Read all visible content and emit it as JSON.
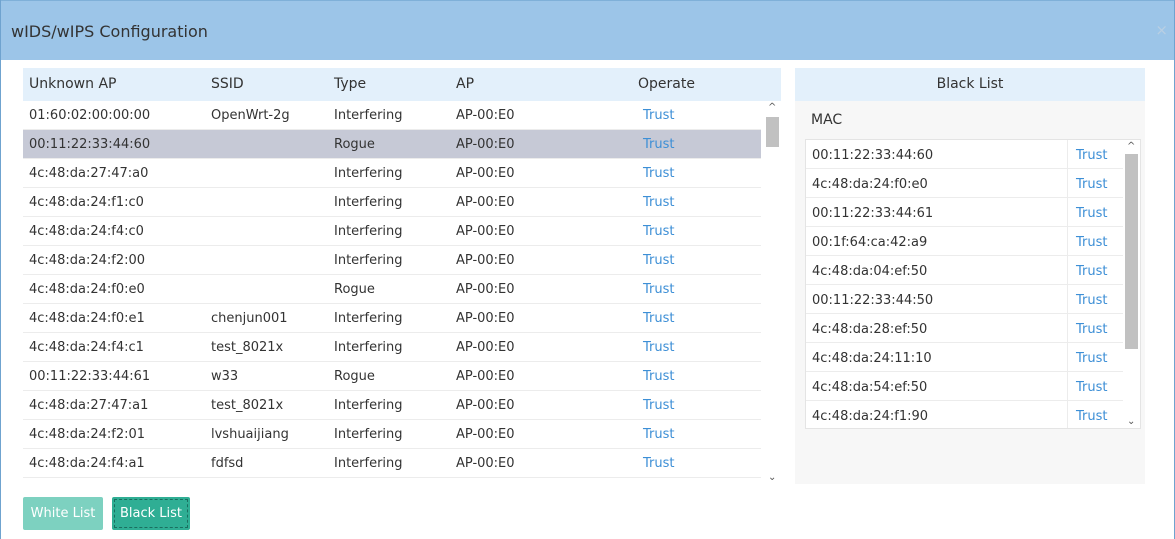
{
  "dialog": {
    "title": "wIDS/wIPS Configuration",
    "close": "×"
  },
  "left_table": {
    "headers": [
      "Unknown AP",
      "SSID",
      "Type",
      "AP",
      "Operate"
    ],
    "rows": [
      {
        "mac": "01:60:02:00:00:00",
        "ssid": "OpenWrt-2g",
        "type": "Interfering",
        "ap": "AP-00:E0",
        "op": "Trust"
      },
      {
        "mac": "00:11:22:33:44:60",
        "ssid": "",
        "type": "Rogue",
        "ap": "AP-00:E0",
        "op": "Trust"
      },
      {
        "mac": "4c:48:da:27:47:a0",
        "ssid": "",
        "type": "Interfering",
        "ap": "AP-00:E0",
        "op": "Trust"
      },
      {
        "mac": "4c:48:da:24:f1:c0",
        "ssid": "",
        "type": "Interfering",
        "ap": "AP-00:E0",
        "op": "Trust"
      },
      {
        "mac": "4c:48:da:24:f4:c0",
        "ssid": "",
        "type": "Interfering",
        "ap": "AP-00:E0",
        "op": "Trust"
      },
      {
        "mac": "4c:48:da:24:f2:00",
        "ssid": "",
        "type": "Interfering",
        "ap": "AP-00:E0",
        "op": "Trust"
      },
      {
        "mac": "4c:48:da:24:f0:e0",
        "ssid": "",
        "type": "Rogue",
        "ap": "AP-00:E0",
        "op": "Trust"
      },
      {
        "mac": "4c:48:da:24:f0:e1",
        "ssid": "chenjun001",
        "type": "Interfering",
        "ap": "AP-00:E0",
        "op": "Trust"
      },
      {
        "mac": "4c:48:da:24:f4:c1",
        "ssid": "test_8021x",
        "type": "Interfering",
        "ap": "AP-00:E0",
        "op": "Trust"
      },
      {
        "mac": "00:11:22:33:44:61",
        "ssid": "w33",
        "type": "Rogue",
        "ap": "AP-00:E0",
        "op": "Trust"
      },
      {
        "mac": "4c:48:da:27:47:a1",
        "ssid": "test_8021x",
        "type": "Interfering",
        "ap": "AP-00:E0",
        "op": "Trust"
      },
      {
        "mac": "4c:48:da:24:f2:01",
        "ssid": "lvshuaijiang",
        "type": "Interfering",
        "ap": "AP-00:E0",
        "op": "Trust"
      },
      {
        "mac": "4c:48:da:24:f4:a1",
        "ssid": "fdfsd",
        "type": "Interfering",
        "ap": "AP-00:E0",
        "op": "Trust"
      }
    ],
    "selected_row": 1
  },
  "black_list": {
    "title": "Black List",
    "mac_label": "MAC",
    "rows": [
      {
        "mac": "00:11:22:33:44:60",
        "op": "Trust"
      },
      {
        "mac": "4c:48:da:24:f0:e0",
        "op": "Trust"
      },
      {
        "mac": "00:11:22:33:44:61",
        "op": "Trust"
      },
      {
        "mac": "00:1f:64:ca:42:a9",
        "op": "Trust"
      },
      {
        "mac": "4c:48:da:04:ef:50",
        "op": "Trust"
      },
      {
        "mac": "00:11:22:33:44:50",
        "op": "Trust"
      },
      {
        "mac": "4c:48:da:28:ef:50",
        "op": "Trust"
      },
      {
        "mac": "4c:48:da:24:11:10",
        "op": "Trust"
      },
      {
        "mac": "4c:48:da:54:ef:50",
        "op": "Trust"
      },
      {
        "mac": "4c:48:da:24:f1:90",
        "op": "Trust"
      }
    ]
  },
  "buttons": {
    "white_list": "White List",
    "black_list": "Black List"
  },
  "scroll_icons": {
    "up": "^",
    "down": "⌄"
  },
  "colors": {
    "header_bg": "#9cc5e8",
    "table_head_bg": "#e3f0fb",
    "link": "#3d8fd6",
    "selected_row": "#c6c9d6",
    "btn_light": "#7dd1c0",
    "btn_dark": "#2fae94"
  }
}
